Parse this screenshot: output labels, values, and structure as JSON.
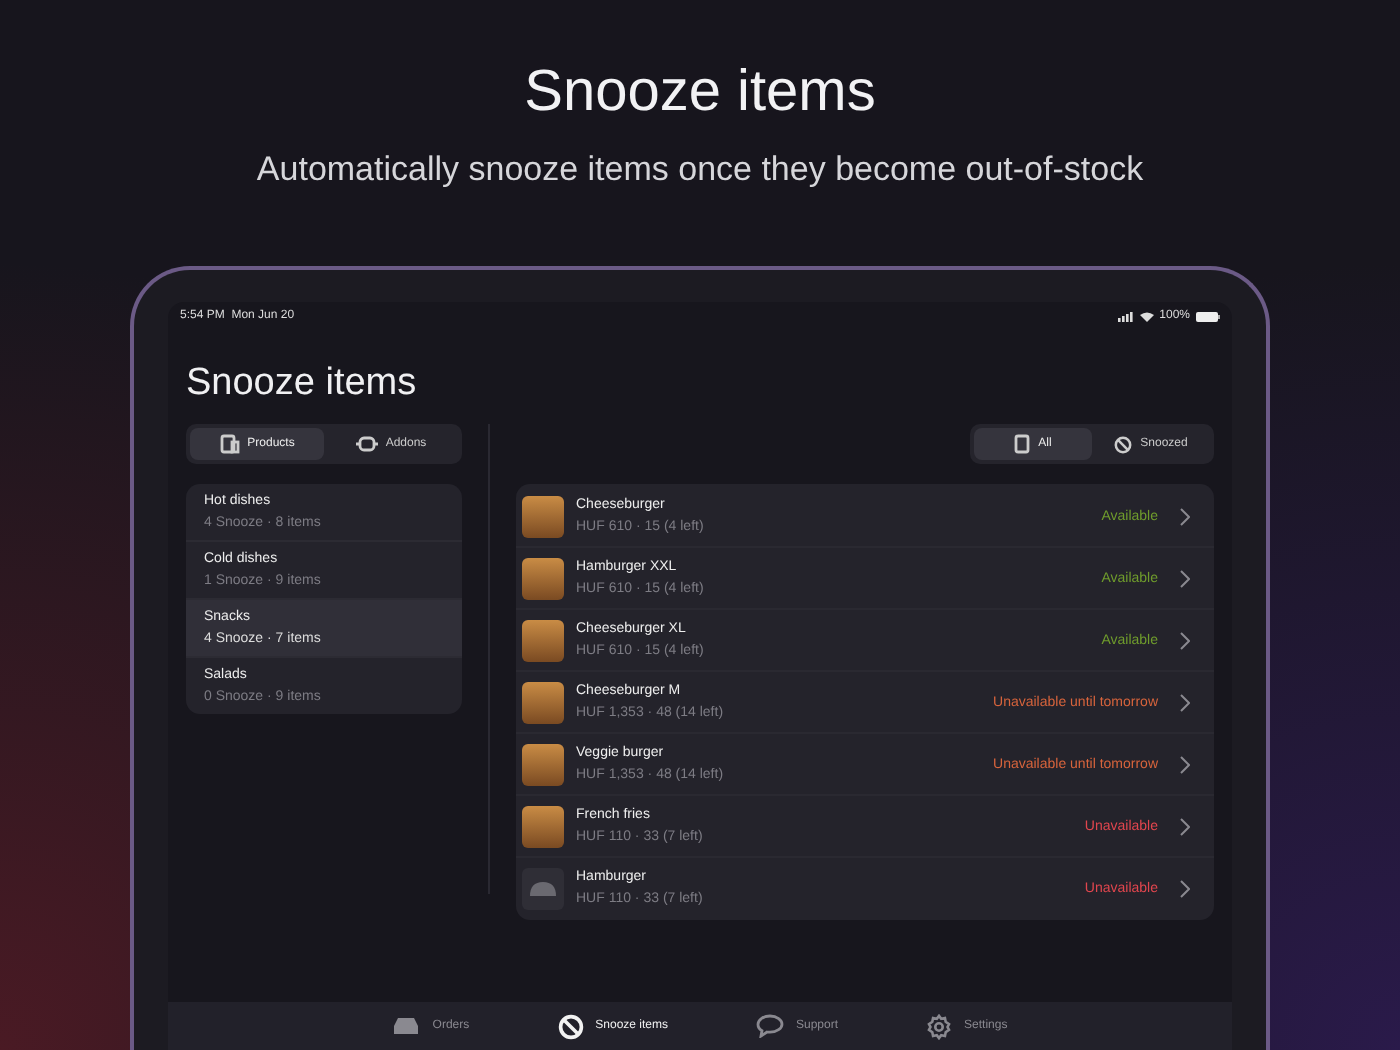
{
  "headline": "Snooze items",
  "subtitle": "Automatically snooze items once they become out-of-stock",
  "status_bar": {
    "time": "5:54 PM",
    "date": "Mon Jun 20",
    "battery": "100%"
  },
  "page_title": "Snooze items",
  "type_tabs": [
    {
      "label": "Products",
      "selected": true,
      "kind": "products"
    },
    {
      "label": "Addons",
      "selected": false,
      "kind": "addons"
    }
  ],
  "categories": [
    {
      "name": "Hot dishes",
      "meta": "4 Snooze · 8 items",
      "selected": false
    },
    {
      "name": "Cold dishes",
      "meta": "1 Snooze · 9 items",
      "selected": false
    },
    {
      "name": "Snacks",
      "meta": "4 Snooze · 7 items",
      "selected": true
    },
    {
      "name": "Salads",
      "meta": "0 Snooze · 9 items",
      "selected": false
    }
  ],
  "filter_tabs": [
    {
      "label": "All",
      "selected": true,
      "kind": "all"
    },
    {
      "label": "Snoozed",
      "selected": false,
      "kind": "snoozed"
    }
  ],
  "items": [
    {
      "name": "Cheeseburger",
      "meta": "HUF 610 · 15 (4 left)",
      "status": "Available",
      "color": "#6f9c2c",
      "kind": "photo"
    },
    {
      "name": "Hamburger XXL",
      "meta": "HUF 610 · 15 (4 left)",
      "status": "Available",
      "color": "#6f9c2c",
      "kind": "photo"
    },
    {
      "name": "Cheeseburger XL",
      "meta": "HUF 610 · 15 (4 left)",
      "status": "Available",
      "color": "#6f9c2c",
      "kind": "photo"
    },
    {
      "name": "Cheeseburger M",
      "meta": "HUF 1,353 · 48 (14 left)",
      "status": "Unavailable until tomorrow",
      "color": "#d8643c",
      "kind": "photo"
    },
    {
      "name": "Veggie burger",
      "meta": "HUF 1,353 · 48 (14 left)",
      "status": "Unavailable until tomorrow",
      "color": "#d8643c",
      "kind": "photo"
    },
    {
      "name": "French fries",
      "meta": "HUF 110 · 33 (7 left)",
      "status": "Unavailable",
      "color": "#e2464e",
      "kind": "photo"
    },
    {
      "name": "Hamburger",
      "meta": "HUF 110 · 33 (7 left)",
      "status": "Unavailable",
      "color": "#e2464e",
      "kind": "placeholder"
    }
  ],
  "bottom_tabs": [
    {
      "label": "Orders",
      "selected": false,
      "kind": "orders"
    },
    {
      "label": "Snooze items",
      "selected": true,
      "kind": "snooze"
    },
    {
      "label": "Support",
      "selected": false,
      "kind": "support"
    },
    {
      "label": "Settings",
      "selected": false,
      "kind": "settings"
    }
  ]
}
